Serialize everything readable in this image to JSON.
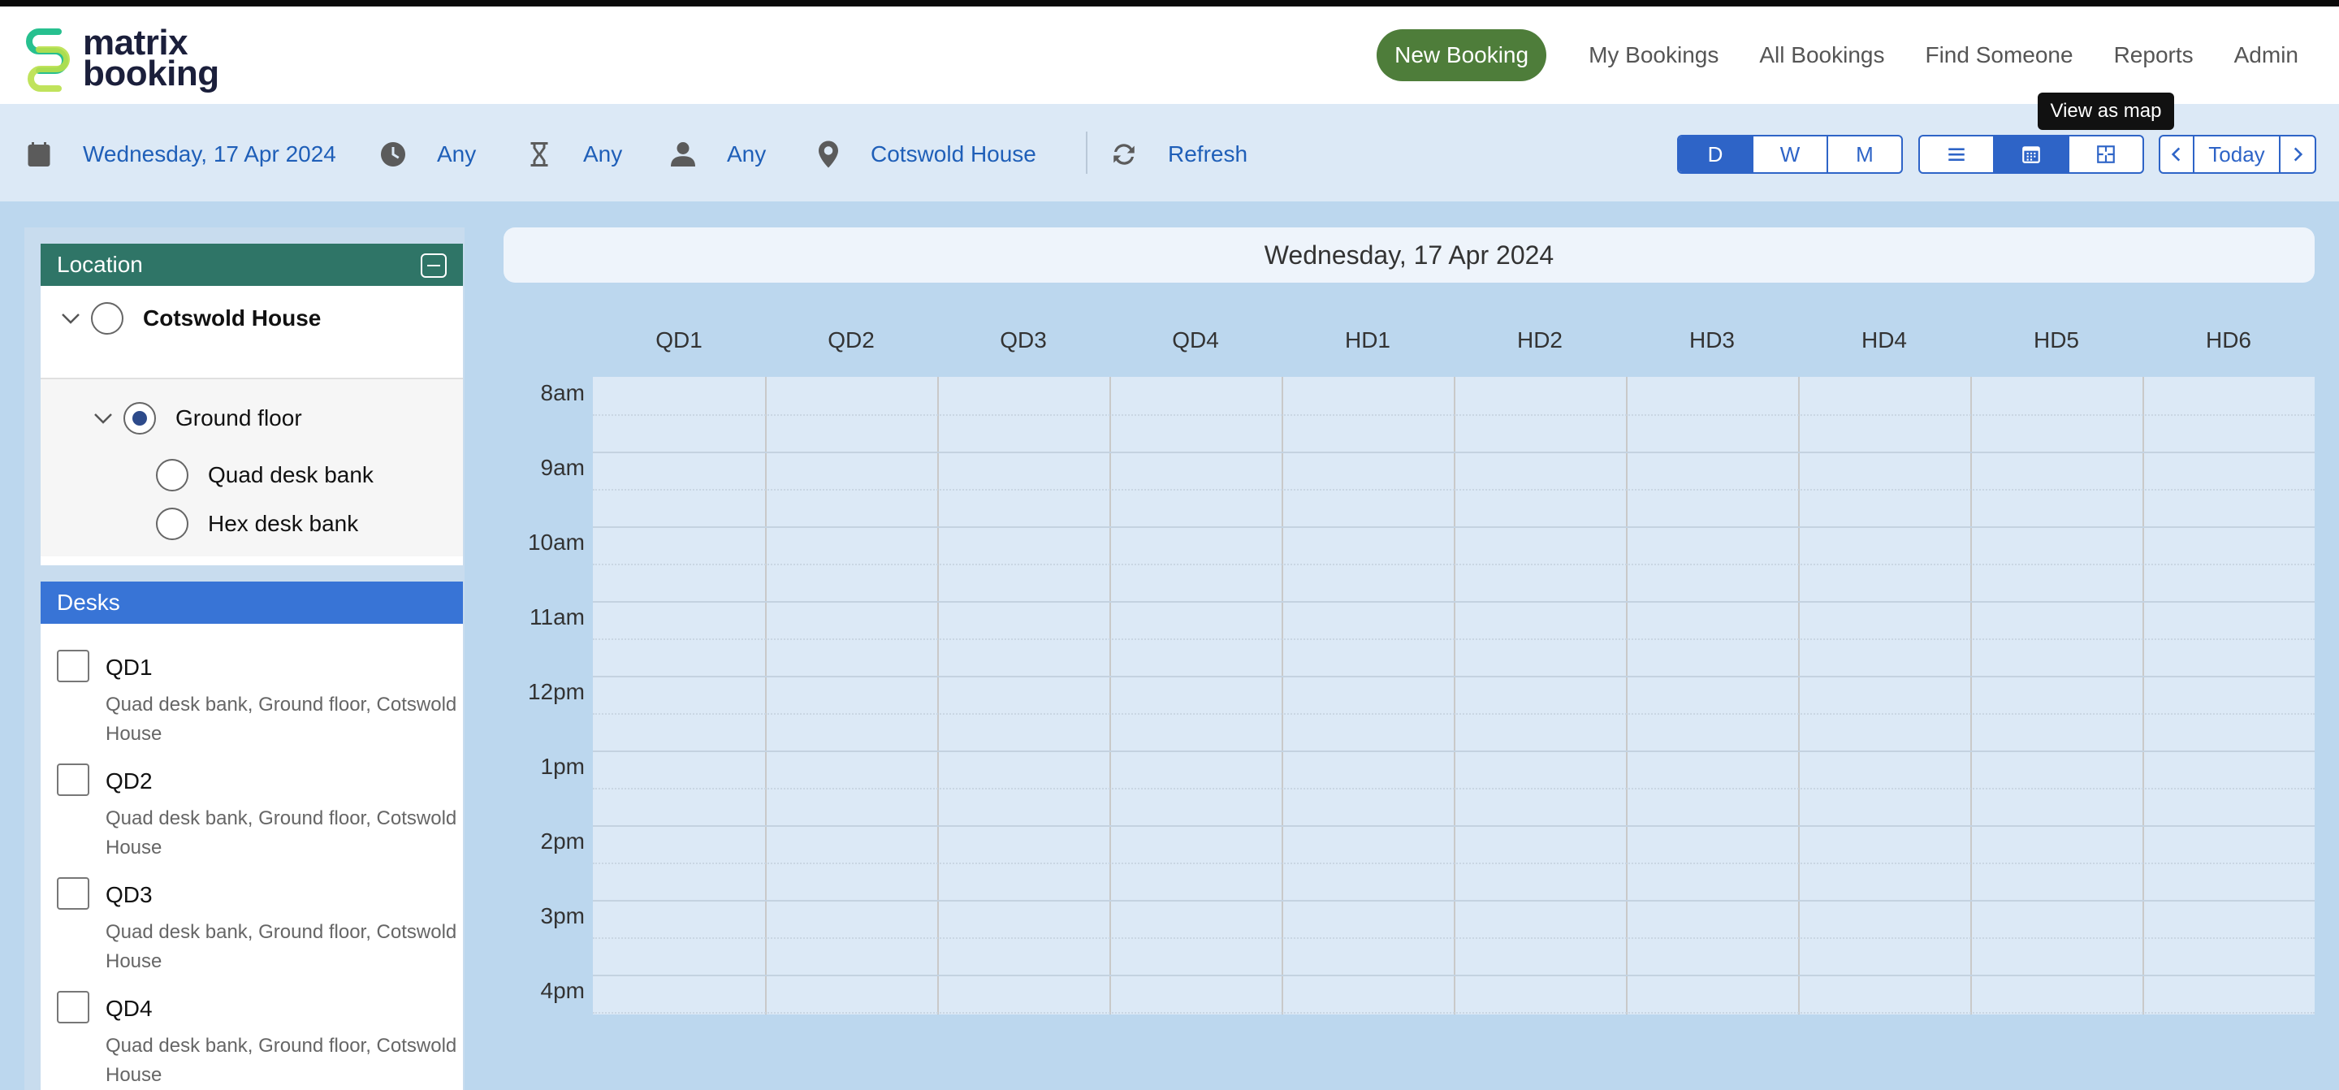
{
  "brand": {
    "line1": "matrix",
    "line2": "booking"
  },
  "nav": {
    "new_booking": "New Booking",
    "my_bookings": "My Bookings",
    "all_bookings": "All Bookings",
    "find_someone": "Find Someone",
    "reports": "Reports",
    "admin": "Admin"
  },
  "toolbar": {
    "date": "Wednesday, 17 Apr 2024",
    "time": "Any",
    "duration": "Any",
    "person": "Any",
    "location": "Cotswold House",
    "refresh": "Refresh",
    "range": {
      "day": "D",
      "week": "W",
      "month": "M"
    },
    "today": "Today",
    "tooltip": "View as map"
  },
  "sidebar": {
    "location": {
      "title": "Location",
      "root": "Cotswold House",
      "floor": "Ground floor",
      "areas": [
        "Quad desk bank",
        "Hex desk bank"
      ]
    },
    "desks": {
      "title": "Desks",
      "items": [
        {
          "name": "QD1",
          "desc": "Quad desk bank, Ground floor, Cotswold House"
        },
        {
          "name": "QD2",
          "desc": "Quad desk bank, Ground floor, Cotswold House"
        },
        {
          "name": "QD3",
          "desc": "Quad desk bank, Ground floor, Cotswold House"
        },
        {
          "name": "QD4",
          "desc": "Quad desk bank, Ground floor, Cotswold House"
        }
      ]
    }
  },
  "schedule": {
    "date_title": "Wednesday, 17 Apr 2024",
    "columns": [
      "QD1",
      "QD2",
      "QD3",
      "QD4",
      "HD1",
      "HD2",
      "HD3",
      "HD4",
      "HD5",
      "HD6"
    ],
    "times": [
      "8am",
      "9am",
      "10am",
      "11am",
      "12pm",
      "1pm",
      "2pm",
      "3pm",
      "4pm"
    ]
  },
  "colors": {
    "brand_green": "#4e7d3a",
    "accent_blue": "#2e64c7",
    "location_header": "#2f7567",
    "desks_header": "#3874d6"
  }
}
